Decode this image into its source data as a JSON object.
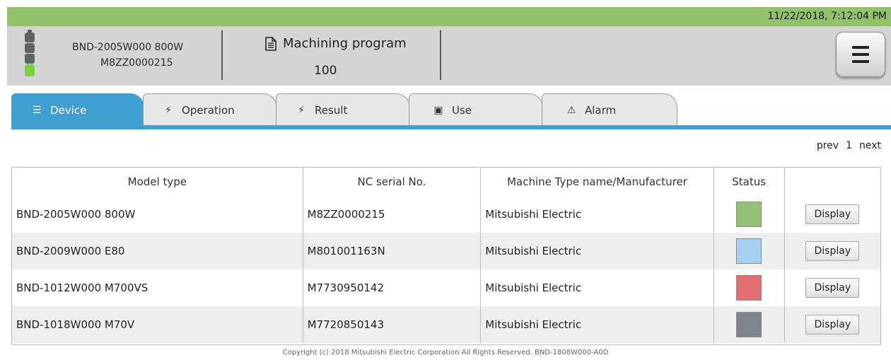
{
  "status_bar": {
    "datetime": "11/22/2018, 7:12:04 PM",
    "color": "#93c06c"
  },
  "header": {
    "device_name": "BND-2005W000 800W",
    "device_serial": "M8ZZ0000215",
    "program_label": "Machining program",
    "program_icon": "document-icon",
    "program_number": "100",
    "menu_icon": "hamburger-menu-icon"
  },
  "tabs": [
    {
      "label": "Device",
      "icon": "list-icon",
      "active": true
    },
    {
      "label": "Operation",
      "icon": "lightning-icon"
    },
    {
      "label": "Result",
      "icon": "lightning-icon"
    },
    {
      "label": "Use",
      "icon": "device-icon"
    },
    {
      "label": "Alarm",
      "icon": "warning-icon"
    }
  ],
  "pager": {
    "prev": "prev",
    "page": "1",
    "next": "next"
  },
  "table": {
    "columns": [
      "Model type",
      "NC serial No.",
      "Machine Type name/Manufacturer",
      "Status",
      ""
    ],
    "rows": [
      {
        "model": "BND-2005W000 800W",
        "serial": "M8ZZ0000215",
        "maker": "Mitsubishi Electric",
        "status_color": "#94c172",
        "action": "Display"
      },
      {
        "model": "BND-2009W000 E80",
        "serial": "M801001163N",
        "maker": "Mitsubishi Electric",
        "status_color": "#a6d0f0",
        "action": "Display"
      },
      {
        "model": "BND-1012W000 M700VS",
        "serial": "M7730950142",
        "maker": "Mitsubishi Electric",
        "status_color": "#e06e6e",
        "action": "Display"
      },
      {
        "model": "BND-1018W000 M70V",
        "serial": "M7720850143",
        "maker": "Mitsubishi Electric",
        "status_color": "#7c858c",
        "action": "Display"
      }
    ]
  },
  "footer": {
    "copyright": "Copyright (c) 2018 Mitsubishi Electric Corporation All Rights Reserved. BND-1808W000-A0D"
  },
  "colors": {
    "accent": "#3f9fd1",
    "header_bg": "#d4d4d4"
  }
}
